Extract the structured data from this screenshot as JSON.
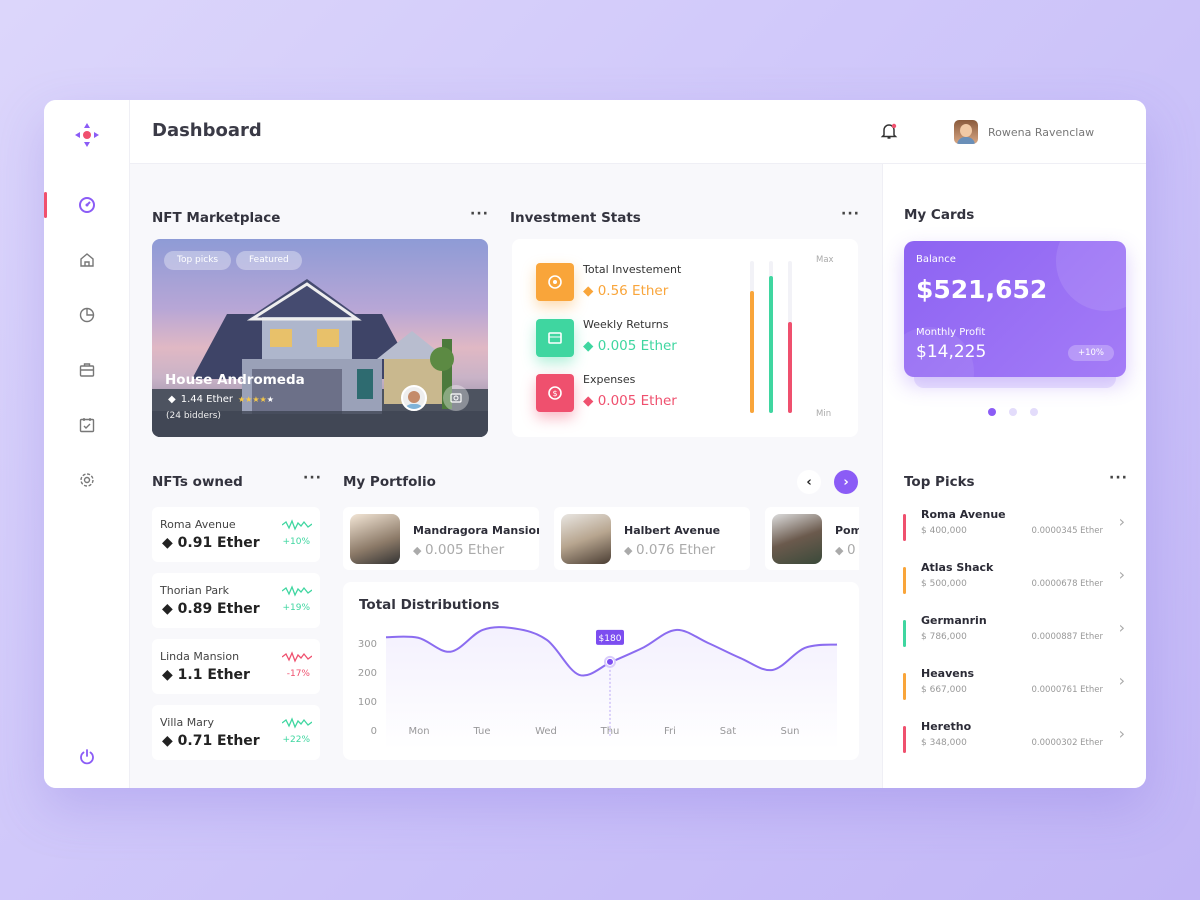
{
  "header": {
    "title": "Dashboard",
    "user_name": "Rowena Ravenclaw",
    "notification_icon": "bell-icon"
  },
  "sidebar": {
    "items": [
      {
        "icon": "speedometer-icon",
        "active": true
      },
      {
        "icon": "home-icon"
      },
      {
        "icon": "pie-chart-icon"
      },
      {
        "icon": "briefcase-icon"
      },
      {
        "icon": "calendar-icon"
      },
      {
        "icon": "gear-icon"
      }
    ],
    "logout_icon": "power-icon",
    "active_color": "#f0506e"
  },
  "nft_marketplace": {
    "title": "NFT Marketplace",
    "tags": [
      "Top picks",
      "Featured"
    ],
    "name": "House Andromeda",
    "price": "1.44 Ether",
    "rating": 4,
    "rating_max": 5,
    "bidders": "(24 bidders)"
  },
  "investment_stats": {
    "title": "Investment Stats",
    "max_label": "Max",
    "min_label": "Min",
    "items": [
      {
        "label": "Total Investement",
        "value": "0.56 Ether",
        "color": "#f9a53a",
        "level": 0.8
      },
      {
        "label": "Weekly Returns",
        "value": "0.005 Ether",
        "color": "#3fd6a0",
        "level": 0.9
      },
      {
        "label": "Expenses",
        "value": "0.005 Ether",
        "color": "#ef506e",
        "level": 0.6
      }
    ]
  },
  "nfts_owned": {
    "title": "NFTs owned",
    "items": [
      {
        "name": "Roma Avenue",
        "value": "0.91 Ether",
        "change": "+10%",
        "trend": "up"
      },
      {
        "name": "Thorian Park",
        "value": "0.89 Ether",
        "change": "+19%",
        "trend": "up"
      },
      {
        "name": "Linda Mansion",
        "value": "1.1 Ether",
        "change": "-17%",
        "trend": "down"
      },
      {
        "name": "Villa Mary",
        "value": "0.71 Ether",
        "change": "+22%",
        "trend": "up"
      }
    ]
  },
  "portfolio": {
    "title": "My Portfolio",
    "items": [
      {
        "name": "Mandragora Mansion",
        "value": "0.005 Ether"
      },
      {
        "name": "Halbert Avenue",
        "value": "0.076 Ether"
      },
      {
        "name": "Pom",
        "value": "0"
      }
    ]
  },
  "chart_data": {
    "type": "line",
    "title": "Total Distributions",
    "categories": [
      "Mon",
      "Tue",
      "Wed",
      "Thu",
      "Fri",
      "Sat",
      "Sun"
    ],
    "yticks": [
      0,
      100,
      200,
      300
    ],
    "ylim": [
      0,
      380
    ],
    "grid": false,
    "values": [
      320,
      318,
      270,
      345,
      350,
      310,
      190,
      235,
      285,
      345,
      300,
      248,
      207,
      283,
      295
    ],
    "tooltip": {
      "label": "$180",
      "category": "Thu"
    },
    "color": "#8b6cf0"
  },
  "my_cards": {
    "title": "My Cards",
    "balance_label": "Balance",
    "balance": "$521,652",
    "profit_label": "Monthly Profit",
    "profit": "$14,225",
    "profit_change": "+10%",
    "pages": 3,
    "active_page": 1
  },
  "top_picks": {
    "title": "Top Picks",
    "items": [
      {
        "name": "Roma Avenue",
        "price": "$ 400,000",
        "ether": "0.0000345 Ether",
        "color": "#ef506e"
      },
      {
        "name": "Atlas Shack",
        "price": "$ 500,000",
        "ether": "0.0000678 Ether",
        "color": "#f9a53a"
      },
      {
        "name": "Germanrin",
        "price": "$ 786,000",
        "ether": "0.0000887 Ether",
        "color": "#3fd6a0"
      },
      {
        "name": "Heavens",
        "price": "$ 667,000",
        "ether": "0.0000761 Ether",
        "color": "#f9a53a"
      },
      {
        "name": "Heretho",
        "price": "$ 348,000",
        "ether": "0.0000302 Ether",
        "color": "#ef506e"
      }
    ]
  }
}
